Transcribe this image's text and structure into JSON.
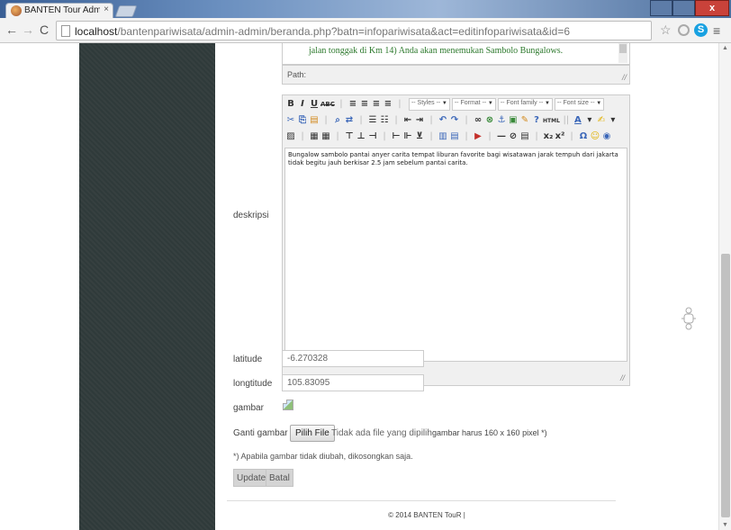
{
  "browser": {
    "tab_title": "BANTEN Tour Administra",
    "tab_close": "×",
    "url_host": "localhost",
    "url_path": "/bantenpariwisata/admin-admin/beranda.php?batn=infopariwisata&act=editinfopariwisata&id=6",
    "back": "←",
    "forward": "→",
    "reload": "C",
    "star": "☆",
    "ext2": "S",
    "menu": "≡",
    "win_close": "x"
  },
  "editor_top": {
    "text": "jalan tonggak di Km 14) Anda akan menemukan Sambolo Bungalows.",
    "path_label": "Path:"
  },
  "form": {
    "deskripsi_label": "deskripsi",
    "latitude_label": "latitude",
    "latitude_value": "-6.270328",
    "longitude_label": "longtitude",
    "longitude_value": "105.83095",
    "gambar_label": "gambar",
    "ganti_gambar_label": "Ganti gambar",
    "colon": ":",
    "file_button": "Pilih File",
    "file_status": "Tidak ada file yang dipilih",
    "file_hint": "gambar harus 160 x 160 pixel   *)",
    "note": "*) Apabila gambar tidak diubah, dikosongkan saja.",
    "update_button": "Update",
    "batal_button": "Batal"
  },
  "editor": {
    "styles_select": "-- Styles --",
    "format_select": "-- Format --",
    "fontfamily_select": "-- Font family --",
    "fontsize_select": "-- Font size --",
    "content": "Bungalow sambolo pantai anyer carita tempat liburan favorite bagi wisatawan jarak tempuh dari jakarta tidak begitu jauh berkisar 2.5 jam sebelum pantai carita."
  },
  "footer": {
    "text": "© 2014 BANTEN TouR |"
  },
  "colors": {
    "sidebar": "#2f3a3a",
    "button_bg": "#d4d4d4",
    "editor_top_text": "#2e7a2e"
  }
}
